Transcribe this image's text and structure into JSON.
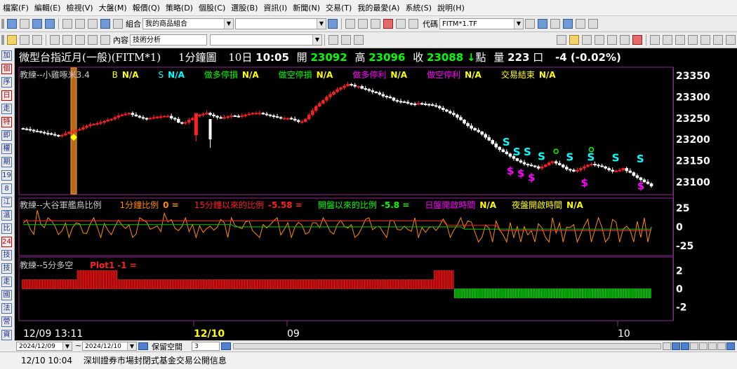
{
  "menu": [
    "檔案(F)",
    "編輯(E)",
    "檢視(V)",
    "大盤(M)",
    "報價(Q)",
    "策略(D)",
    "個股(C)",
    "選股(B)",
    "資訊(I)",
    "新聞(N)",
    "交易(T)",
    "我的最愛(A)",
    "系統(S)",
    "說明(H)"
  ],
  "toolbar2": {
    "combo_label": "組合",
    "combo_value": "我的商品組合",
    "symbol_label": "代碼",
    "symbol_value": "FITM*1.TF"
  },
  "toolbar3": {
    "content_label": "內容",
    "content_value": "技術分析"
  },
  "sidebar": [
    "加",
    "個",
    "序",
    "日",
    "走",
    "特",
    "即",
    "權",
    "期",
    "19",
    "8",
    "江",
    "溫",
    "比",
    "24",
    "技",
    "技",
    "走",
    "國",
    "法",
    "營",
    "資"
  ],
  "quote": {
    "name": "微型台指近月(一般)(FITM*1)",
    "period": "1分鐘圖",
    "day": "10日",
    "time": "10:05",
    "open_label": "開",
    "open": "23092",
    "high_label": "高",
    "high": "23096",
    "close_label": "收",
    "close": "23088",
    "arrow": "↓",
    "points": "點",
    "vol_label": "量",
    "volume": "223",
    "unit": "口",
    "change": "-4 (-0.02%)"
  },
  "panel1": {
    "title": "教練--小雞啄米3.4",
    "items": [
      {
        "label": "B",
        "value": "N/A",
        "color": "#ffff00"
      },
      {
        "label": "S",
        "value": "N/A",
        "color": "#00ffff"
      },
      {
        "label": "做多停損",
        "value": "N/A",
        "color": "#00ff00"
      },
      {
        "label": "做空停損",
        "value": "N/A",
        "color": "#00ff00"
      },
      {
        "label": "做多停利",
        "value": "N/A",
        "color": "#ff00ff"
      },
      {
        "label": "做空停利",
        "value": "N/A",
        "color": "#ff00ff"
      },
      {
        "label": "交易結束",
        "value": "N/A",
        "color": "#ffff00"
      }
    ],
    "ticks": [
      "23350",
      "23300",
      "23250",
      "23200",
      "23150",
      "23100"
    ]
  },
  "panel2": {
    "title": "教練--大谷軍艦鳥比例",
    "items": [
      {
        "label": "1分鐘比例",
        "value": "0 =",
        "color": "#ff8c00"
      },
      {
        "label": "15分鐘以來的比例",
        "value": "-5.58 =",
        "color": "#ff2020"
      },
      {
        "label": "開盤以來的比例",
        "value": "-5.8 =",
        "color": "#00ff00"
      },
      {
        "label": "日盤開啟時間",
        "value": "N/A",
        "color": "#ff00ff"
      },
      {
        "label": "夜盤開啟時間",
        "value": "N/A",
        "color": "#ffff00"
      }
    ],
    "ticks": [
      "25",
      "0",
      "-25"
    ]
  },
  "panel3": {
    "title": "教練--5分多空",
    "plot_label": "Plot1",
    "plot_value": "-1 =",
    "ticks": [
      "2",
      "0",
      "-2"
    ]
  },
  "xaxis": {
    "t0": "12/09 13:11",
    "t1": "12/10",
    "t2": "09",
    "t3": "10"
  },
  "bottom": {
    "date_from": "2024/12/09",
    "tilde": "~",
    "date_to": "2024/12/10",
    "reserve_label": "保留空間",
    "reserve_value": "3"
  },
  "status": {
    "time": "12/10 10:04",
    "news": "深圳證券市場封閉式基金交易公開信息"
  },
  "chart_data": [
    {
      "type": "candlestick",
      "title": "教練--小雞啄米3.4",
      "ylim": [
        23070,
        23370
      ],
      "yticks": [
        23350,
        23300,
        23250,
        23200,
        23150,
        23100
      ],
      "close": [
        23225,
        23224,
        23222,
        23220,
        23219,
        23217,
        23215,
        23214,
        23212,
        23210,
        23209,
        23210,
        23214,
        23217,
        23219,
        23222,
        23224,
        23228,
        23232,
        23235,
        23236,
        23238,
        23240,
        23243,
        23246,
        23248,
        23252,
        23256,
        23258,
        23260,
        23262,
        23258,
        23255,
        23252,
        23250,
        23249,
        23250,
        23252,
        23253,
        23254,
        23255,
        23255,
        23250,
        23248,
        23240,
        23238,
        23240,
        23246,
        23250,
        23255,
        23258,
        23260,
        23262,
        23258,
        23255,
        23252,
        23250,
        23252,
        23254,
        23256,
        23255,
        23254,
        23256,
        23258,
        23260,
        23262,
        23262,
        23262,
        23260,
        23258,
        23256,
        23254,
        23252,
        23250,
        23250,
        23250,
        23248,
        23245,
        23242,
        23242,
        23248,
        23258,
        23268,
        23278,
        23285,
        23292,
        23300,
        23306,
        23312,
        23318,
        23322,
        23326,
        23330,
        23328,
        23325,
        23325,
        23320,
        23318,
        23315,
        23312,
        23310,
        23306,
        23302,
        23300,
        23298,
        23292,
        23290,
        23289,
        23288,
        23285,
        23284,
        23283,
        23285,
        23284,
        23283,
        23282,
        23280,
        23278,
        23274,
        23270,
        23266,
        23262,
        23258,
        23252,
        23246,
        23238,
        23232,
        23226,
        23222,
        23218,
        23212,
        23205,
        23198,
        23190,
        23182,
        23176,
        23171,
        23166,
        23160,
        23155,
        23150,
        23146,
        23142,
        23140,
        23138,
        23136,
        23132,
        23136,
        23140,
        23145,
        23148,
        23144,
        23140,
        23135,
        23130,
        23128,
        23125,
        23128,
        23132,
        23136,
        23140,
        23142,
        23140,
        23138,
        23136,
        23132,
        23128,
        23125,
        23126,
        23128,
        23132,
        23126,
        23122,
        23115,
        23110,
        23105,
        23100,
        23096,
        23090
      ]
    },
    {
      "type": "line",
      "title": "教練--大谷軍艦鳥比例",
      "ylim": [
        -38,
        38
      ],
      "yticks": [
        25,
        0,
        -25
      ],
      "series": [
        {
          "name": "1分鐘比例",
          "color": "#ff8c00"
        },
        {
          "name": "15分鐘以來的比例",
          "color": "#ff2020"
        },
        {
          "name": "開盤以來的比例",
          "color": "#00ff00"
        }
      ]
    },
    {
      "type": "bar",
      "title": "教練--5分多空",
      "ylim": [
        -3.5,
        3.5
      ],
      "yticks": [
        2,
        0,
        -2
      ],
      "values": [
        1,
        1,
        1,
        1,
        1,
        1,
        1,
        1,
        1,
        1,
        1,
        1,
        1,
        1,
        1,
        1,
        1,
        1,
        1,
        2,
        2,
        2,
        2,
        2,
        2,
        2,
        2,
        2,
        2,
        2,
        2,
        2,
        2,
        1,
        1,
        1,
        1,
        1,
        1,
        1,
        1,
        1,
        1,
        1,
        1,
        1,
        1,
        1,
        1,
        1,
        1,
        1,
        1,
        1,
        1,
        1,
        1,
        1,
        1,
        1,
        1,
        1,
        1,
        1,
        1,
        1,
        1,
        1,
        1,
        1,
        1,
        1,
        1,
        1,
        1,
        1,
        1,
        1,
        1,
        1,
        1,
        1,
        1,
        1,
        1,
        1,
        1,
        1,
        1,
        1,
        1,
        1,
        1,
        1,
        1,
        1,
        1,
        1,
        1,
        1,
        1,
        1,
        1,
        1,
        1,
        1,
        1,
        1,
        1,
        1,
        1,
        1,
        1,
        1,
        1,
        1,
        1,
        1,
        1,
        1,
        1,
        1,
        1,
        1,
        1,
        1,
        1,
        1,
        1,
        1,
        1,
        1,
        1,
        1,
        1,
        1,
        1,
        1,
        1,
        1,
        1,
        1,
        2,
        2,
        2,
        2,
        2,
        2,
        2,
        -1,
        -1,
        -1,
        -1,
        -1,
        -1,
        -1,
        -1,
        -1,
        -1,
        -1,
        -1,
        -1,
        -1,
        -1,
        -1,
        -1,
        -1,
        -1,
        -1,
        -1,
        -1,
        -1,
        -1,
        -1,
        -1,
        -1,
        -1,
        -1,
        -1,
        -1,
        -1,
        -1,
        -1,
        -1,
        -1,
        -1,
        -1,
        -1,
        -1,
        -1,
        -1,
        -1,
        -1,
        -1,
        -1,
        -1,
        -1,
        -1,
        -1,
        -1,
        -1,
        -1,
        -1,
        -1,
        -1,
        -1,
        -1,
        -1,
        -1,
        -1,
        -1,
        -1,
        -1,
        -1,
        -1,
        -1,
        -1
      ]
    }
  ]
}
